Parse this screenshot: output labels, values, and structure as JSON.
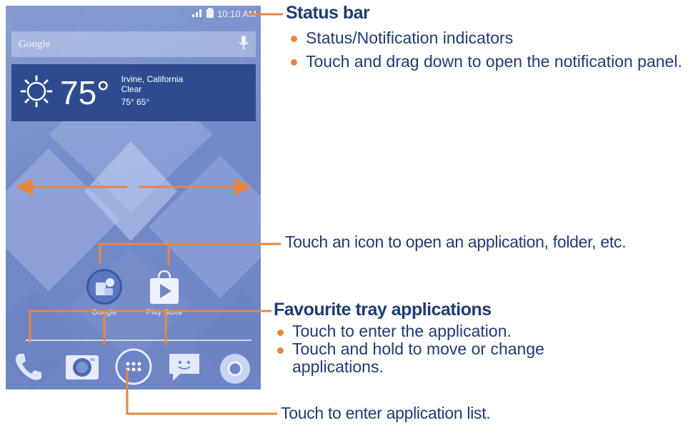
{
  "phone": {
    "status_time": "10:10 AM",
    "search_label": "Google",
    "weather": {
      "temperature": "75°",
      "location": "Irvine, California",
      "condition": "Clear",
      "high_low": "75°  65°"
    },
    "apps": [
      {
        "label": "Google",
        "icon": "google-folder-icon"
      },
      {
        "label": "Play Store",
        "icon": "play-store-icon"
      }
    ],
    "tray": [
      {
        "icon": "phone-icon"
      },
      {
        "icon": "camera-icon"
      },
      {
        "icon": "app-list-icon"
      },
      {
        "icon": "messaging-icon"
      },
      {
        "icon": "chrome-icon"
      }
    ]
  },
  "callouts": {
    "status_bar": {
      "heading": "Status bar",
      "bullets": [
        "Status/Notification indicators",
        "Touch and drag down to open the notification panel."
      ]
    },
    "icons": {
      "text": "Touch an icon to open an application, folder, etc."
    },
    "favourite_tray": {
      "heading": "Favourite tray applications",
      "bullets": [
        "Touch to enter the application.",
        "Touch and hold to move or change applications."
      ]
    },
    "app_list": {
      "text": "Touch to enter application list."
    }
  },
  "colors": {
    "callout_line": "#e9863f",
    "text": "#1f3b73",
    "widget": "#2f4b8f"
  }
}
